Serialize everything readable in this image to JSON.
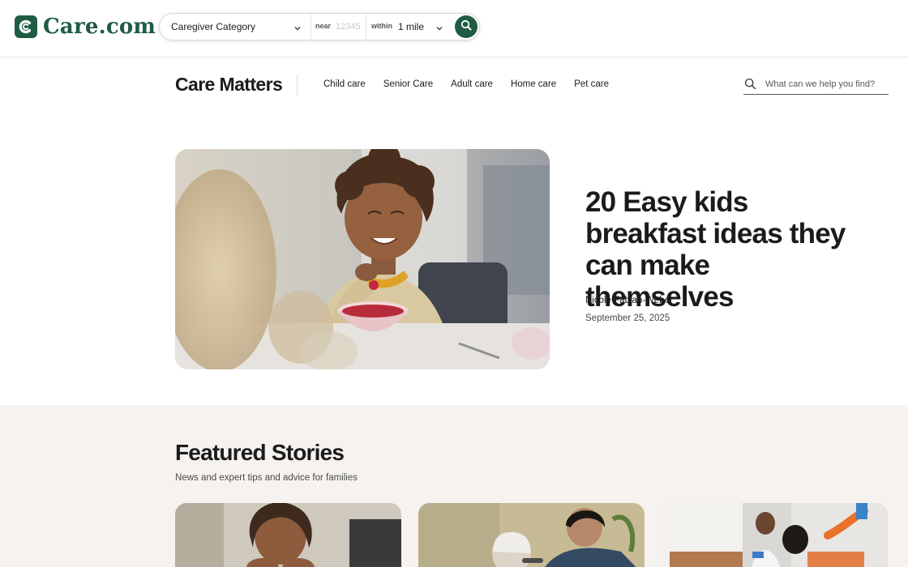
{
  "header": {
    "logo_text": "Care.com",
    "brand_color": "#1f5c43",
    "search": {
      "category_label": "Caregiver Category",
      "near_label": "near",
      "zip_placeholder": "12345",
      "within_label": "within",
      "distance_value": "1 mile",
      "search_icon": "search-icon"
    }
  },
  "section_nav": {
    "title": "Care Matters",
    "items": [
      {
        "label": "Child care"
      },
      {
        "label": "Senior Care"
      },
      {
        "label": "Adult care"
      },
      {
        "label": "Home care"
      },
      {
        "label": "Pet care"
      }
    ],
    "search_placeholder": "What can we help you find?"
  },
  "hero": {
    "title": "20 Easy kids breakfast ideas they can make themselves",
    "author": "Nicole Fabian-Weber",
    "date": "September 25, 2025",
    "image": "girl-eating-breakfast-photo"
  },
  "featured": {
    "title": "Featured Stories",
    "subtitle": "News and expert tips and advice for families",
    "cards": [
      {
        "image": "bored-child-photo"
      },
      {
        "image": "senior-caregiver-photo"
      },
      {
        "image": "cleaning-home-photo"
      }
    ]
  }
}
